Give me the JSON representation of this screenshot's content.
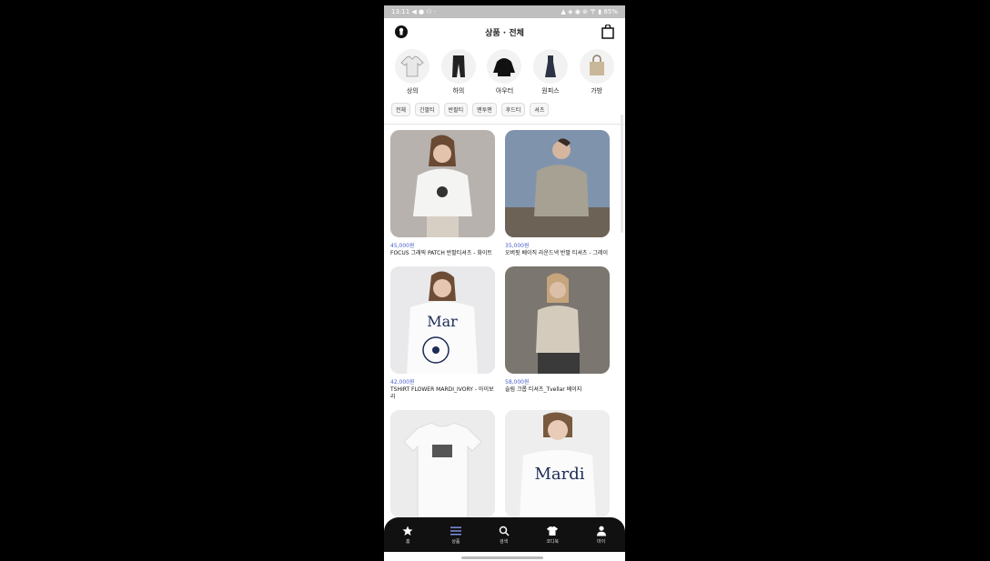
{
  "status": {
    "left": "13:11 ◀ ● ⚇ ·",
    "right": "▲ ◈ ◉ ⊛ 〒 ▮ 85%"
  },
  "header": {
    "title": "상품 · 전체"
  },
  "categories": [
    {
      "label": "상의"
    },
    {
      "label": "하의"
    },
    {
      "label": "아우터"
    },
    {
      "label": "원피스"
    },
    {
      "label": "가방"
    }
  ],
  "chips": [
    "전체",
    "긴팔티",
    "반팔티",
    "맨투맨",
    "후드티",
    "셔츠"
  ],
  "products": [
    {
      "price": "45,000원",
      "name": "FOCUS 그래픽 PATCH 반팔티셔츠 - 화이트"
    },
    {
      "price": "35,000원",
      "name": "오버핏 베이직 라운드넥 반팔 티셔츠 - 그레이"
    },
    {
      "price": "42,000원",
      "name": "TSHIRT FLOWER MARDI_IVORY - 아이보리"
    },
    {
      "price": "58,000원",
      "name": "슬림 크롭 티셔츠_Tvellar 베이지"
    },
    {
      "price": "",
      "name": ""
    },
    {
      "price": "",
      "name": ""
    }
  ],
  "nav": [
    {
      "label": "홈",
      "icon": "star-icon"
    },
    {
      "label": "상품",
      "icon": "menu-icon"
    },
    {
      "label": "검색",
      "icon": "search-icon"
    },
    {
      "label": "코디북",
      "icon": "shirt-icon"
    },
    {
      "label": "마이",
      "icon": "person-icon"
    }
  ],
  "colors": {
    "accent": "#4a63c7",
    "nav_bg": "#111111"
  }
}
